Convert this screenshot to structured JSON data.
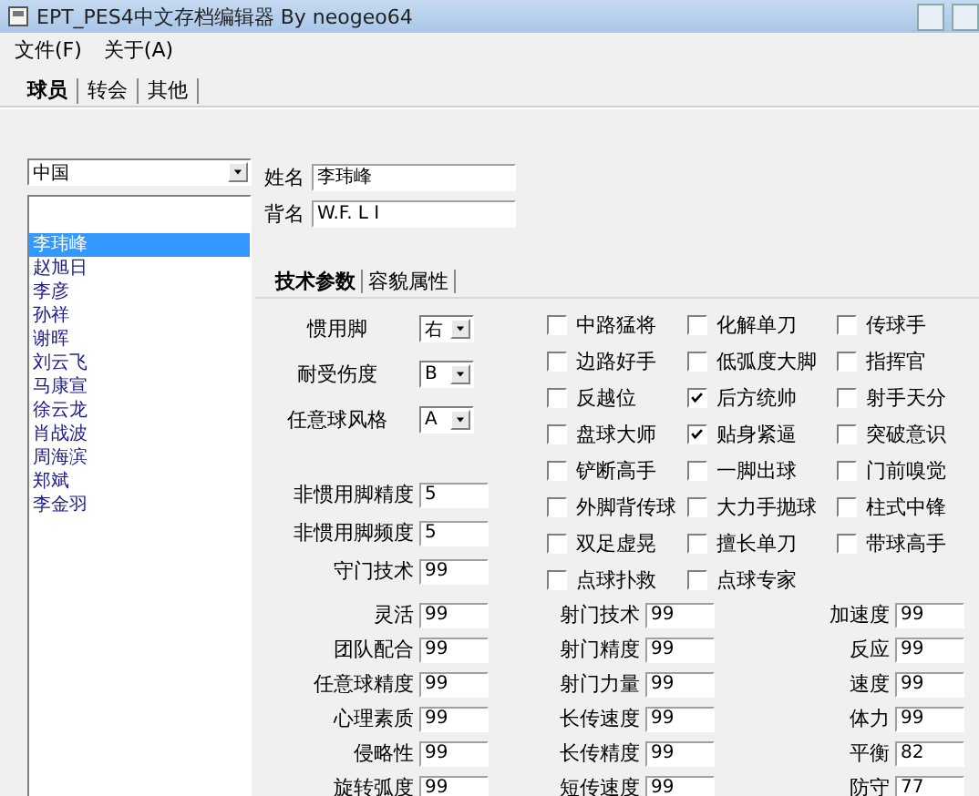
{
  "window": {
    "title": "EPT_PES4中文存档编辑器 By neogeo64"
  },
  "menu": [
    "文件(F)",
    "关于(A)"
  ],
  "tabs": [
    {
      "label": "球员",
      "selected": true
    },
    {
      "label": "转会",
      "selected": false
    },
    {
      "label": "其他",
      "selected": false
    }
  ],
  "team_select": {
    "value": "中国"
  },
  "players": [
    {
      "name": "李玮峰",
      "selected": true
    },
    {
      "name": "赵旭日",
      "selected": false
    },
    {
      "name": "李彦",
      "selected": false
    },
    {
      "name": "孙祥",
      "selected": false
    },
    {
      "name": "谢晖",
      "selected": false
    },
    {
      "name": "刘云飞",
      "selected": false
    },
    {
      "name": "马康宣",
      "selected": false
    },
    {
      "name": "徐云龙",
      "selected": false
    },
    {
      "name": "肖战波",
      "selected": false
    },
    {
      "name": "周海滨",
      "selected": false
    },
    {
      "name": "郑斌",
      "selected": false
    },
    {
      "name": "李金羽",
      "selected": false
    }
  ],
  "name_fields": [
    {
      "label": "姓名",
      "value": "李玮峰"
    },
    {
      "label": "背名",
      "value": "W.F. L I"
    }
  ],
  "sub_tabs": [
    {
      "label": "技术参数",
      "selected": true
    },
    {
      "label": "容貌属性",
      "selected": false
    }
  ],
  "selects": [
    {
      "label": "惯用脚",
      "value": "右"
    },
    {
      "label": "耐受伤度",
      "value": "B"
    },
    {
      "label": "任意球风格",
      "value": "A"
    }
  ],
  "skills": [
    {
      "label": "中路猛将",
      "checked": false
    },
    {
      "label": "化解单刀",
      "checked": false
    },
    {
      "label": "传球手",
      "checked": false
    },
    {
      "label": "边路好手",
      "checked": false
    },
    {
      "label": "低弧度大脚",
      "checked": false
    },
    {
      "label": "指挥官",
      "checked": false
    },
    {
      "label": "反越位",
      "checked": false
    },
    {
      "label": "后方统帅",
      "checked": true
    },
    {
      "label": "射手天分",
      "checked": false
    },
    {
      "label": "盘球大师",
      "checked": false
    },
    {
      "label": "贴身紧逼",
      "checked": true
    },
    {
      "label": "突破意识",
      "checked": false
    },
    {
      "label": "铲断高手",
      "checked": false
    },
    {
      "label": "一脚出球",
      "checked": false
    },
    {
      "label": "门前嗅觉",
      "checked": false
    },
    {
      "label": "外脚背传球",
      "checked": false
    },
    {
      "label": "大力手抛球",
      "checked": false
    },
    {
      "label": "柱式中锋",
      "checked": false
    },
    {
      "label": "双足虚晃",
      "checked": false
    },
    {
      "label": "擅长单刀",
      "checked": false
    },
    {
      "label": "带球高手",
      "checked": false
    },
    {
      "label": "点球扑救",
      "checked": false
    },
    {
      "label": "点球专家",
      "checked": false
    }
  ],
  "weak_foot": [
    {
      "label": "非惯用脚精度",
      "value": "5"
    },
    {
      "label": "非惯用脚频度",
      "value": "5"
    },
    {
      "label": "守门技术",
      "value": "99"
    }
  ],
  "stats": [
    {
      "label": "灵活",
      "value": "99"
    },
    {
      "label": "射门技术",
      "value": "99"
    },
    {
      "label": "加速度",
      "value": "99"
    },
    {
      "label": "团队配合",
      "value": "99"
    },
    {
      "label": "射门精度",
      "value": "99"
    },
    {
      "label": "反应",
      "value": "99"
    },
    {
      "label": "任意球精度",
      "value": "99"
    },
    {
      "label": "射门力量",
      "value": "99"
    },
    {
      "label": "速度",
      "value": "99"
    },
    {
      "label": "心理素质",
      "value": "99"
    },
    {
      "label": "长传速度",
      "value": "99"
    },
    {
      "label": "体力",
      "value": "99"
    },
    {
      "label": "侵略性",
      "value": "99"
    },
    {
      "label": "长传精度",
      "value": "99"
    },
    {
      "label": "平衡",
      "value": "82"
    },
    {
      "label": "旋转弧度",
      "value": "99"
    },
    {
      "label": "短传速度",
      "value": "99"
    },
    {
      "label": "防守",
      "value": "77"
    }
  ]
}
